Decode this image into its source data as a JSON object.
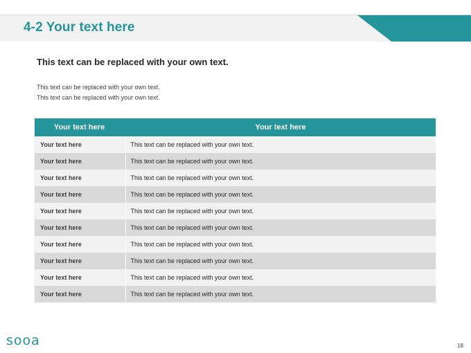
{
  "slide": {
    "title": "4-2 Your text here",
    "subheading": "This text can be replaced with your own text.",
    "body_lines": [
      "This text can be replaced with your own text.",
      "This text can be replaced with your own text."
    ],
    "page_number": "18",
    "logo": "sooa"
  },
  "table": {
    "headers": [
      "Your text here",
      "Your text here"
    ],
    "rows": [
      [
        "Your text here",
        "This text can be replaced with your own text."
      ],
      [
        "Your text here",
        "This text can be replaced with your own text."
      ],
      [
        "Your text here",
        "This text can be replaced with your own text."
      ],
      [
        "Your text here",
        "This text can be replaced with your own text."
      ],
      [
        "Your text here",
        "This text can be replaced with your own text."
      ],
      [
        "Your text here",
        "This text can be replaced with your own text."
      ],
      [
        "Your text here",
        "This text can be replaced with your own text."
      ],
      [
        "Your text here",
        "This text can be replaced with your own text."
      ],
      [
        "Your text here",
        "This text can be replaced with your own text."
      ],
      [
        "Your text here",
        "This text can be replaced with your own text."
      ]
    ]
  },
  "colors": {
    "accent": "#25959c",
    "band": "#f2f2f2",
    "row_light": "#f2f2f2",
    "row_dark": "#d9d9d9"
  }
}
